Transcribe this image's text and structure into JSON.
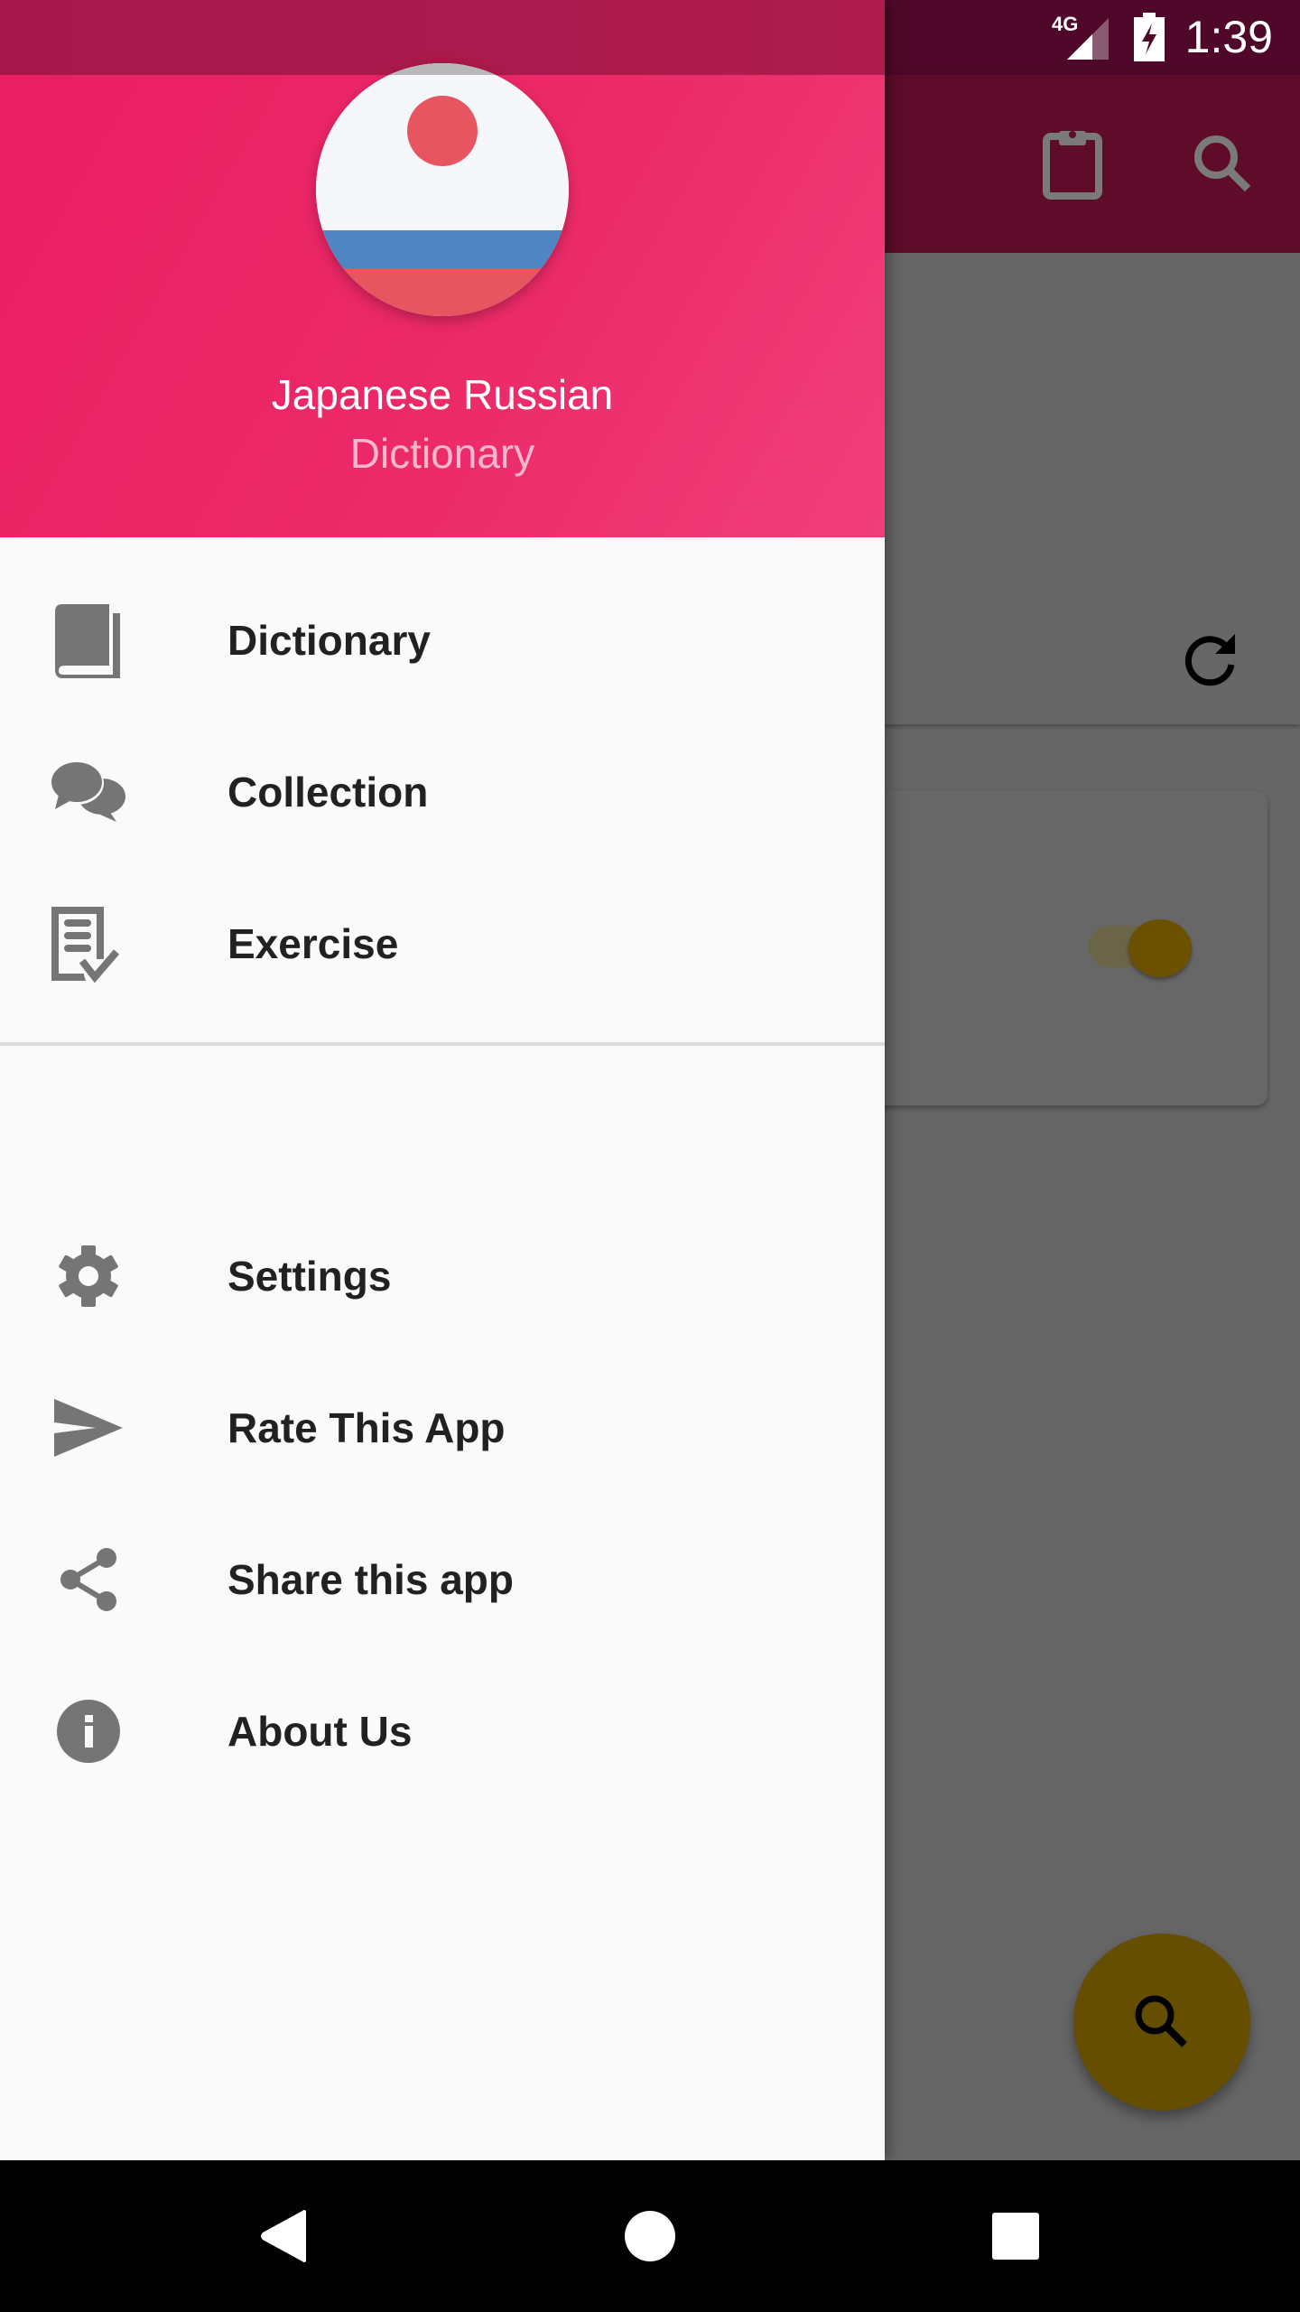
{
  "status_bar": {
    "time": "1:39",
    "network": "4G",
    "icons": [
      "signal-icon",
      "battery-charging-icon"
    ]
  },
  "background_app": {
    "app_bar": {
      "actions": [
        {
          "name": "clipboard",
          "icon": "clipboard-icon"
        },
        {
          "name": "search",
          "icon": "search-icon"
        }
      ]
    },
    "refresh_icon": "refresh-icon",
    "toggle": {
      "state": "on",
      "accent": "#f5c000"
    },
    "fab": {
      "icon": "search-icon",
      "color": "#ffc107"
    }
  },
  "drawer": {
    "header": {
      "title": "Japanese Russian",
      "subtitle": "Dictionary",
      "avatar": "japan-russia-flag",
      "color": "#e91e63"
    },
    "primary_items": [
      {
        "label": "Dictionary",
        "icon": "book-icon"
      },
      {
        "label": "Collection",
        "icon": "chat-bubbles-icon"
      },
      {
        "label": "Exercise",
        "icon": "checklist-icon"
      }
    ],
    "secondary_items": [
      {
        "label": "Settings",
        "icon": "gear-icon"
      },
      {
        "label": "Rate This App",
        "icon": "send-icon"
      },
      {
        "label": "Share this app",
        "icon": "share-icon"
      },
      {
        "label": "About Us",
        "icon": "info-icon"
      }
    ]
  },
  "nav_bar": {
    "buttons": [
      {
        "name": "back",
        "icon": "back-icon"
      },
      {
        "name": "home",
        "icon": "home-icon"
      },
      {
        "name": "recents",
        "icon": "recents-icon"
      }
    ]
  }
}
